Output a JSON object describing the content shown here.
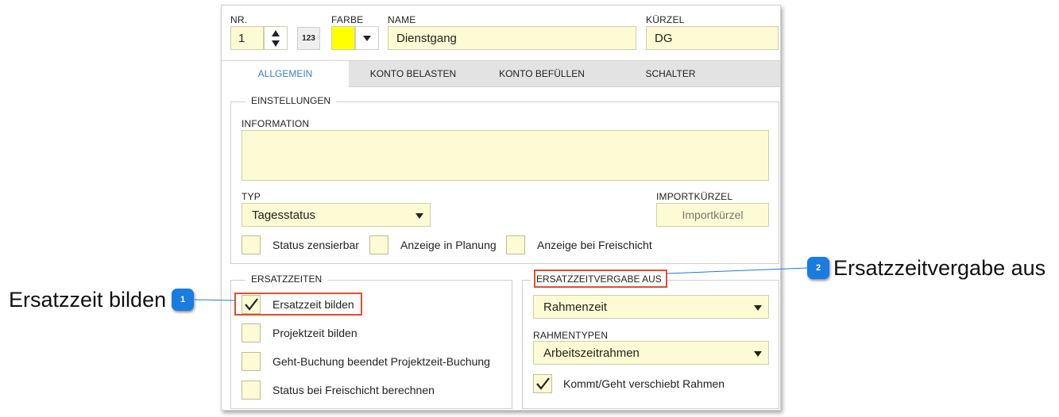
{
  "header": {
    "nr_label": "NR.",
    "nr_value": "1",
    "numpad_label": "123",
    "farbe_label": "FARBE",
    "farbe_color": "#ffff00",
    "name_label": "NAME",
    "name_value": "Dienstgang",
    "kuerzel_label": "KÜRZEL",
    "kuerzel_value": "DG"
  },
  "tabs": [
    {
      "label": "ALLGEMEIN",
      "active": true
    },
    {
      "label": "KONTO BELASTEN",
      "active": false
    },
    {
      "label": "KONTO BEFÜLLEN",
      "active": false
    },
    {
      "label": "SCHALTER",
      "active": false
    }
  ],
  "einstellungen": {
    "title": "EINSTELLUNGEN",
    "information_label": "INFORMATION",
    "information_value": "",
    "typ_label": "TYP",
    "typ_value": "Tagesstatus",
    "importkuerzel_label": "IMPORTKÜRZEL",
    "importkuerzel_placeholder": "Importkürzel",
    "checkboxes": [
      {
        "label": "Status zensierbar",
        "checked": false
      },
      {
        "label": "Anzeige in Planung",
        "checked": false
      },
      {
        "label": "Anzeige bei Freischicht",
        "checked": false
      }
    ]
  },
  "ersatzzeiten": {
    "title": "ERSATZZEITEN",
    "checkboxes": [
      {
        "label": "Ersatzzeit bilden",
        "checked": true
      },
      {
        "label": "Projektzeit bilden",
        "checked": false
      },
      {
        "label": "Geht-Buchung beendet Projektzeit-Buchung",
        "checked": false
      },
      {
        "label": "Status bei Freischicht berechnen",
        "checked": false
      }
    ]
  },
  "ersatzzeitvergabe": {
    "title": "ERSATZZEITVERGABE AUS",
    "mode_value": "Rahmenzeit",
    "rahmentypen_label": "RAHMENTYPEN",
    "rahmentypen_value": "Arbeitszeitrahmen",
    "kommt_geht_label": "Kommt/Geht verschiebt Rahmen",
    "kommt_geht_checked": true
  },
  "callouts": [
    {
      "number": "1",
      "text": "Ersatzzeit bilden"
    },
    {
      "number": "2",
      "text": "Ersatzzeitvergabe aus"
    }
  ],
  "colors": {
    "field_bg": "#fdfbd3",
    "accent_blue": "#3a7fc6",
    "badge_blue": "#1a7be0",
    "highlight": "#e0502a"
  }
}
